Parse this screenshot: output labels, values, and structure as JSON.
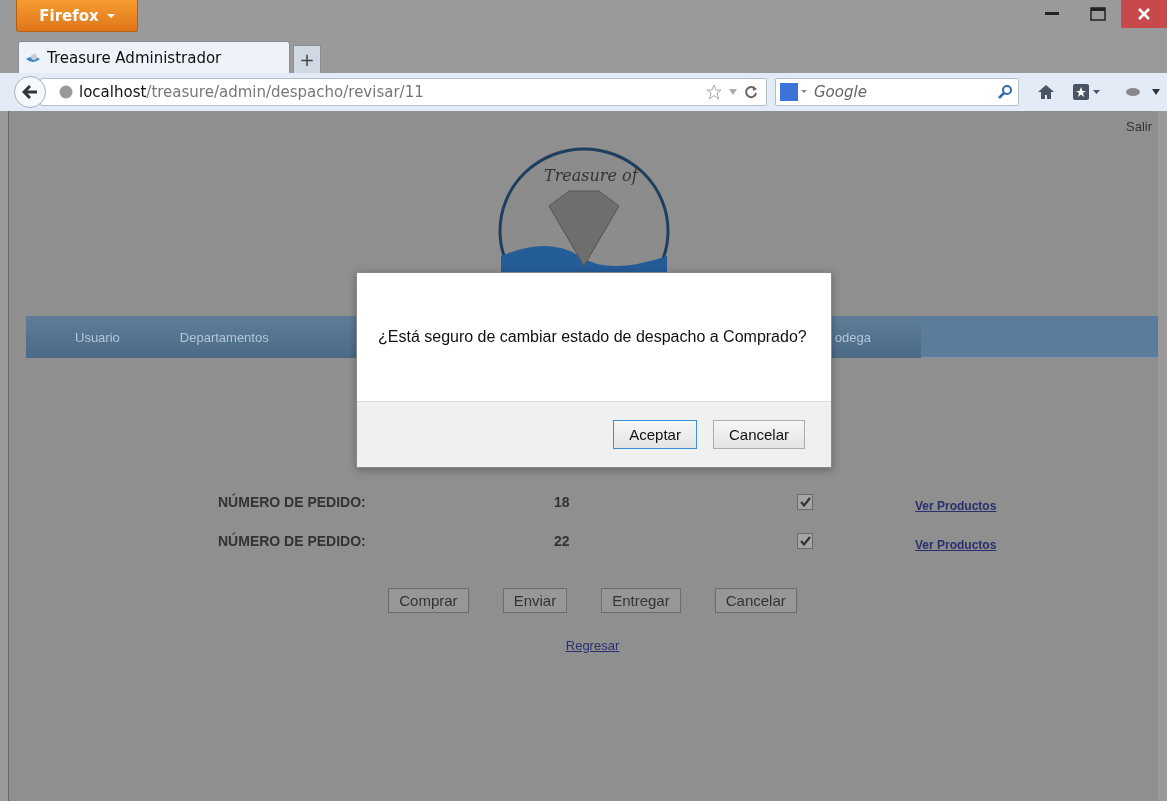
{
  "browser": {
    "menu_button": "Firefox",
    "tabs": [
      {
        "title": "Treasure Administrador",
        "selected": true
      }
    ],
    "new_tab": "+",
    "url_host": "localhost",
    "url_path": "/treasure/admin/despacho/revisar/11",
    "search_placeholder": "Google"
  },
  "page": {
    "logout": "Salir",
    "logo_text": "Treasure of",
    "nav": [
      {
        "label": "Usuario"
      },
      {
        "label": "Departamentos"
      },
      {
        "label": "odega"
      }
    ],
    "orders": [
      {
        "label": "NÚMERO DE PEDIDO:",
        "number": "18",
        "checked": true,
        "link": "Ver Productos"
      },
      {
        "label": "NÚMERO DE PEDIDO:",
        "number": "22",
        "checked": true,
        "link": "Ver Productos"
      }
    ],
    "actions": [
      "Comprar",
      "Enviar",
      "Entregar",
      "Cancelar"
    ],
    "back_link": "Regresar"
  },
  "dialog": {
    "message": "¿Está seguro de cambiar estado de despacho a Comprado?",
    "buttons": [
      "Aceptar",
      "Cancelar"
    ]
  }
}
